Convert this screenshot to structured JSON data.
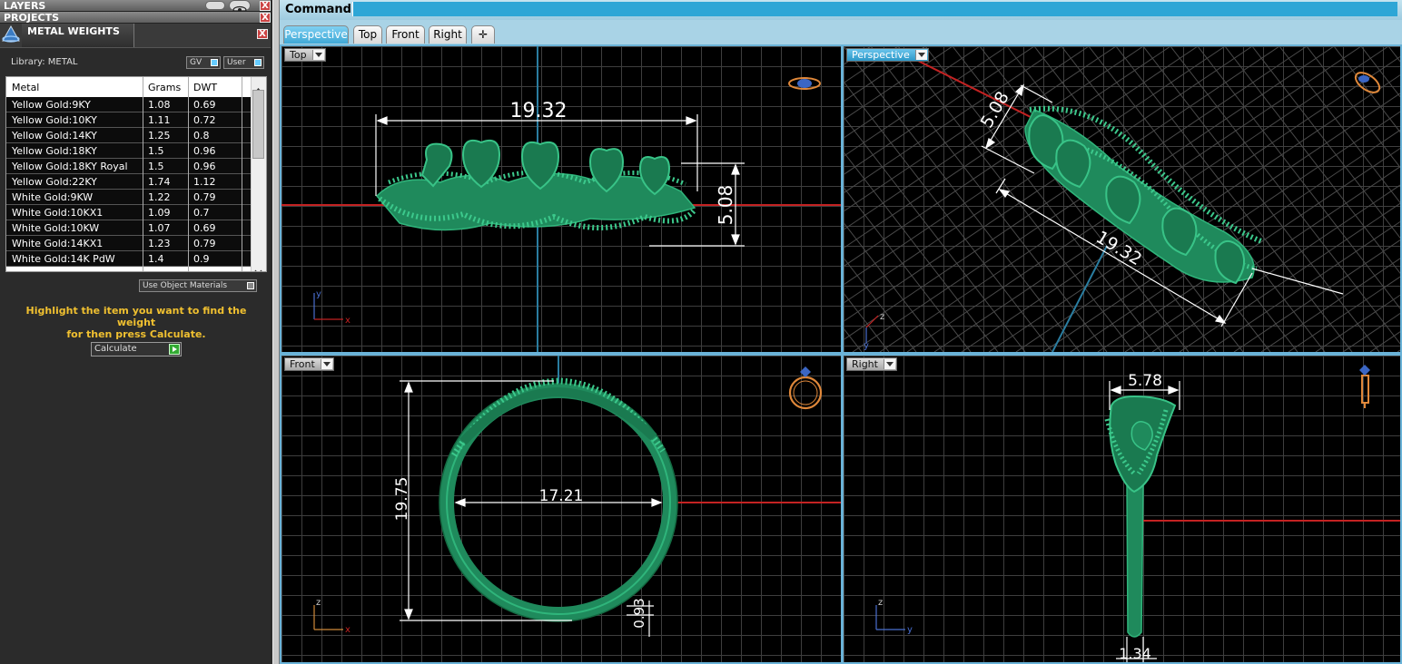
{
  "panels": {
    "layers_title": "LAYERS",
    "projects_title": "PROJECTS",
    "close_glyph": "X"
  },
  "metal_weights": {
    "title": "METAL WEIGHTS",
    "library_label": "Library: METAL",
    "gv_label": "GV",
    "user_label": "User",
    "columns": [
      "Metal",
      "Grams",
      "DWT"
    ],
    "rows": [
      {
        "metal": "Yellow Gold:9KY",
        "grams": "1.08",
        "dwt": "0.69"
      },
      {
        "metal": "Yellow Gold:10KY",
        "grams": "1.11",
        "dwt": "0.72"
      },
      {
        "metal": "Yellow Gold:14KY",
        "grams": "1.25",
        "dwt": "0.8"
      },
      {
        "metal": "Yellow Gold:18KY",
        "grams": "1.5",
        "dwt": "0.96"
      },
      {
        "metal": "Yellow Gold:18KY Royal",
        "grams": "1.5",
        "dwt": "0.96"
      },
      {
        "metal": "Yellow Gold:22KY",
        "grams": "1.74",
        "dwt": "1.12"
      },
      {
        "metal": "White Gold:9KW",
        "grams": "1.22",
        "dwt": "0.79"
      },
      {
        "metal": "White Gold:10KX1",
        "grams": "1.09",
        "dwt": "0.7"
      },
      {
        "metal": "White Gold:10KW",
        "grams": "1.07",
        "dwt": "0.69"
      },
      {
        "metal": "White Gold:14KX1",
        "grams": "1.23",
        "dwt": "0.79"
      },
      {
        "metal": "White Gold:14K PdW",
        "grams": "1.4",
        "dwt": "0.9"
      }
    ],
    "use_object_materials": "Use Object Materials",
    "hint_line1": "Highlight the item you want to find the weight",
    "hint_line2": "for then press Calculate.",
    "calculate_label": "Calculate"
  },
  "command": {
    "label": "Command:",
    "value": ""
  },
  "view_tabs": [
    "Perspective",
    "Top",
    "Front",
    "Right"
  ],
  "active_view_tab": "Perspective",
  "add_tab_glyph": "✛",
  "viewports": {
    "top": {
      "label": "Top",
      "dim_width": "19.32",
      "dim_height": "5.08",
      "axis_a": "y",
      "axis_b": "x"
    },
    "perspective": {
      "label": "Perspective",
      "dim_width": "19.32",
      "dim_height": "5.08",
      "axis_a": "z",
      "axis_b": "y"
    },
    "front": {
      "label": "Front",
      "dim_inner": "17.21",
      "dim_height": "19.75",
      "dim_thickness": "0.93",
      "axis_a": "z",
      "axis_b": "x"
    },
    "right": {
      "label": "Right",
      "dim_top": "5.78",
      "dim_bottom": "1.34",
      "axis_a": "z",
      "axis_b": "y"
    }
  },
  "colors": {
    "model_green": "#1f8a5c",
    "grid_line": "#3e3e3e",
    "axis_red": "#c42222",
    "axis_blue": "#2a7da0",
    "dimension": "#ffffff",
    "hint_text": "#f0c030",
    "viewport_border": "#6ab3d8"
  },
  "icons": {
    "panel_close": "close-icon",
    "layers_toggle": "toggle-icon",
    "layers_visibility": "eye-icon",
    "app_logo": "app-logo-icon",
    "calculate_go": "play-arrow-icon",
    "view_cube": "ring-orientation-icon",
    "dropdown": "chevron-down-icon"
  }
}
